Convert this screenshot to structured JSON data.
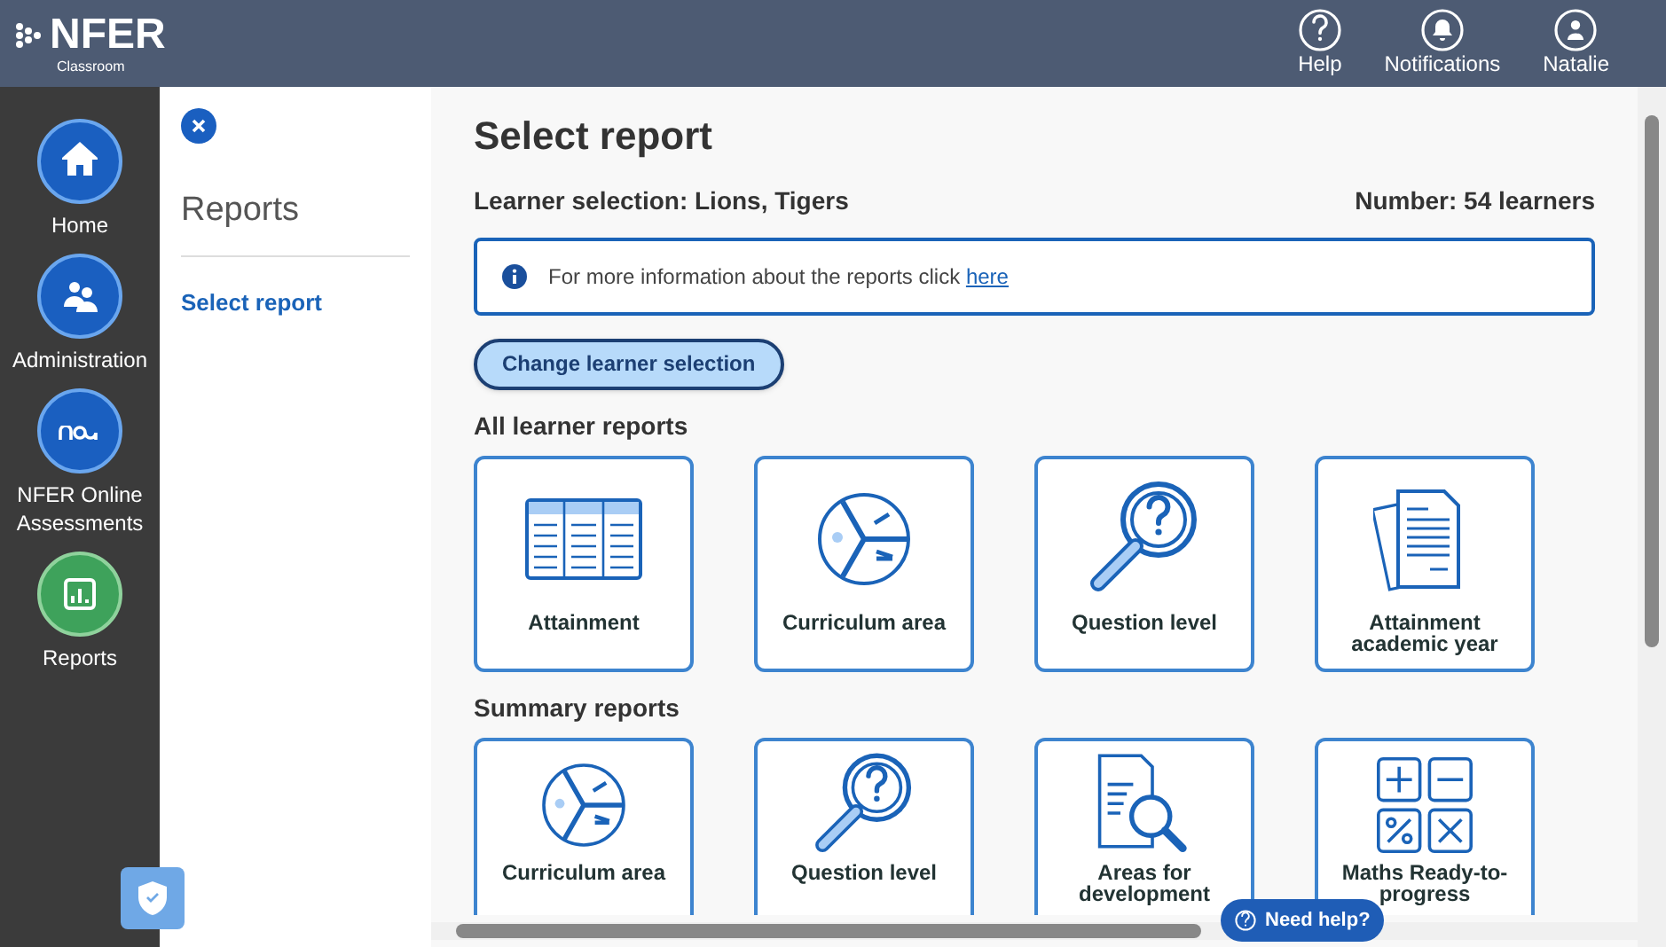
{
  "header": {
    "logo": "NFER",
    "logo_subtitle": "Classroom",
    "actions": [
      {
        "label": "Help",
        "kind": "help"
      },
      {
        "label": "Notifications",
        "kind": "bell"
      },
      {
        "label": "Natalie",
        "kind": "user"
      }
    ]
  },
  "nav": [
    {
      "label": "Home",
      "kind": "home",
      "selected": false
    },
    {
      "label": "Administration",
      "kind": "people",
      "selected": false
    },
    {
      "label": "NFER Online Assessments",
      "kind": "noa",
      "selected": false
    },
    {
      "label": "Reports",
      "kind": "reports",
      "selected": true
    }
  ],
  "subnav": {
    "title": "Reports",
    "items": [
      {
        "label": "Select report",
        "selected": true
      }
    ]
  },
  "main": {
    "title": "Select report",
    "learner_selection_label": "Learner selection:",
    "learner_selection": "Lions, Tigers",
    "number": "Number: 54 learners",
    "info": {
      "text": "For more information about the reports click",
      "link": "here"
    },
    "change_button": "Change learner selection",
    "sections": [
      {
        "title": "All learner reports",
        "cards": [
          {
            "label": "Attainment",
            "kind": "table"
          },
          {
            "label": "Curriculum area",
            "kind": "pie"
          },
          {
            "label": "Question level",
            "kind": "magnifier"
          },
          {
            "label": "Attainment academic year",
            "kind": "papers"
          }
        ]
      },
      {
        "title": "Summary reports",
        "cards": [
          {
            "label": "Curriculum area",
            "kind": "pie"
          },
          {
            "label": "Question level",
            "kind": "magnifier"
          },
          {
            "label": "Areas for development",
            "kind": "document"
          },
          {
            "label": "Maths Ready-to-progress",
            "kind": "maths"
          }
        ]
      }
    ]
  },
  "help_button": "Need help?"
}
